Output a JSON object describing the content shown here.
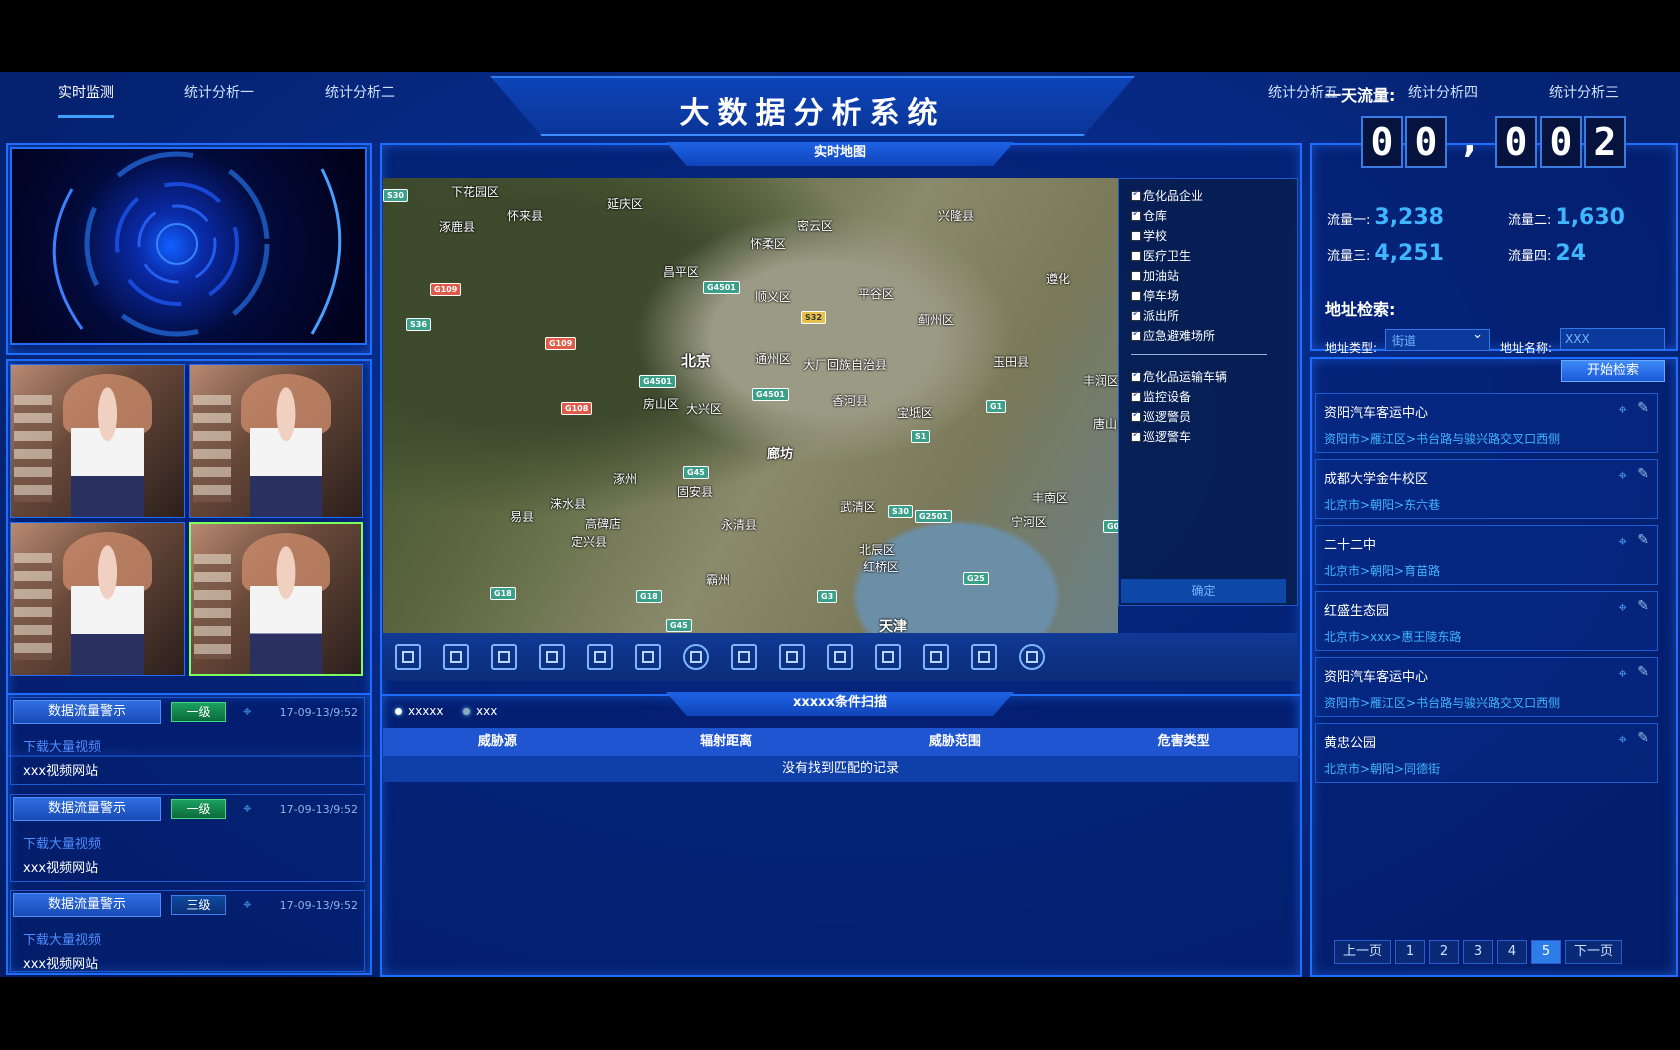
{
  "header": {
    "title": "大数据分析系统",
    "nav_left": [
      "实时监测",
      "统计分析一",
      "统计分析二"
    ],
    "nav_right": [
      "统计分析五",
      "统计分析四",
      "统计分析三"
    ]
  },
  "map_panel": {
    "tab": "实时地图",
    "cities": [
      "下花园区",
      "延庆区",
      "怀来县",
      "涿鹿县",
      "密云区",
      "兴隆县",
      "怀柔区",
      "昌平区",
      "顺义区",
      "平谷区",
      "遵化",
      "北京",
      "通州区",
      "大厂回族自治县",
      "蓟州区",
      "玉田县",
      "房山区",
      "大兴区",
      "香河县",
      "宝坻区",
      "廊坊",
      "涿州",
      "固安县",
      "武清区",
      "丰南区",
      "易县",
      "涞水县",
      "高碑店",
      "永清县",
      "宁河区",
      "定兴县",
      "北辰区",
      "红桥区",
      "霸州",
      "天津",
      "丰润区",
      "唐山"
    ],
    "roads": [
      "S30",
      "G109",
      "G4501",
      "S32",
      "S36",
      "G109",
      "G4501",
      "G4501",
      "G108",
      "G1",
      "S1",
      "G45",
      "S30",
      "G2501",
      "G18",
      "G18",
      "G3",
      "G25",
      "G45",
      "G0"
    ],
    "layers_group1": [
      {
        "label": "危化品企业",
        "checked": true
      },
      {
        "label": "仓库",
        "checked": true
      },
      {
        "label": "学校",
        "checked": false
      },
      {
        "label": "医疗卫生",
        "checked": false
      },
      {
        "label": "加油站",
        "checked": false
      },
      {
        "label": "停车场",
        "checked": false
      },
      {
        "label": "派出所",
        "checked": true
      },
      {
        "label": "应急避难场所",
        "checked": true
      }
    ],
    "layers_group2": [
      {
        "label": "危化品运输车辆",
        "checked": true
      },
      {
        "label": "监控设备",
        "checked": true
      },
      {
        "label": "巡逻警员",
        "checked": true
      },
      {
        "label": "巡逻警车",
        "checked": true
      }
    ],
    "confirm": "确定",
    "tools": [
      "fullscreen-icon",
      "zoom-in-icon",
      "zoom-out-icon",
      "prev-icon",
      "next-icon",
      "map-icon",
      "globe-icon",
      "layers-icon",
      "buildings-icon",
      "flask-icon",
      "tower-icon",
      "truck-icon",
      "window-icon",
      "refresh-icon"
    ]
  },
  "scan_panel": {
    "tab": "xxxxx条件扫描",
    "legend": [
      "xxxxx",
      "xxx"
    ],
    "columns": [
      "威胁源",
      "辐射距离",
      "威胁范围",
      "危害类型"
    ],
    "empty": "没有找到匹配的记录"
  },
  "alerts": [
    {
      "label": "数据流量警示",
      "level": "一级",
      "time": "17-09-13/9:52",
      "sub": "下载大量视频",
      "site": "xxx视频网站"
    },
    {
      "label": "数据流量警示",
      "level": "一级",
      "time": "17-09-13/9:52",
      "sub": "下载大量视频",
      "site": "xxx视频网站"
    },
    {
      "label": "数据流量警示",
      "level": "三级",
      "time": "17-09-13/9:52",
      "sub": "下载大量视频",
      "site": "xxx视频网站"
    }
  ],
  "flow": {
    "title": "一天流量:",
    "digits": [
      "0",
      "0",
      "0",
      "0",
      "2"
    ],
    "stats": [
      {
        "label": "流量一:",
        "value": "3,238"
      },
      {
        "label": "流量二:",
        "value": "1,630"
      },
      {
        "label": "流量三:",
        "value": "4,251"
      },
      {
        "label": "流量四:",
        "value": "24"
      }
    ]
  },
  "address": {
    "title": "地址检索:",
    "type_label": "地址类型:",
    "type_value": "街道",
    "name_label": "地址名称:",
    "name_value": "XXX",
    "search": "开始检索",
    "results": [
      {
        "name": "资阳汽车客运中心",
        "path": "资阳市>雁江区>书台路与骏兴路交叉口西侧"
      },
      {
        "name": "成都大学金牛校区",
        "path": "北京市>朝阳>东六巷"
      },
      {
        "name": "二十二中",
        "path": "北京市>朝阳>育苗路"
      },
      {
        "name": "红盛生态园",
        "path": "北京市>xxx>惠王陵东路"
      },
      {
        "name": "资阳汽车客运中心",
        "path": "资阳市>雁江区>书台路与骏兴路交叉口西侧"
      },
      {
        "name": "黄忠公园",
        "path": "北京市>朝阳>同德街"
      }
    ],
    "pager": {
      "prev": "上一页",
      "pages": [
        "1",
        "2",
        "3",
        "4",
        "5"
      ],
      "current": "5",
      "next": "下一页"
    }
  }
}
